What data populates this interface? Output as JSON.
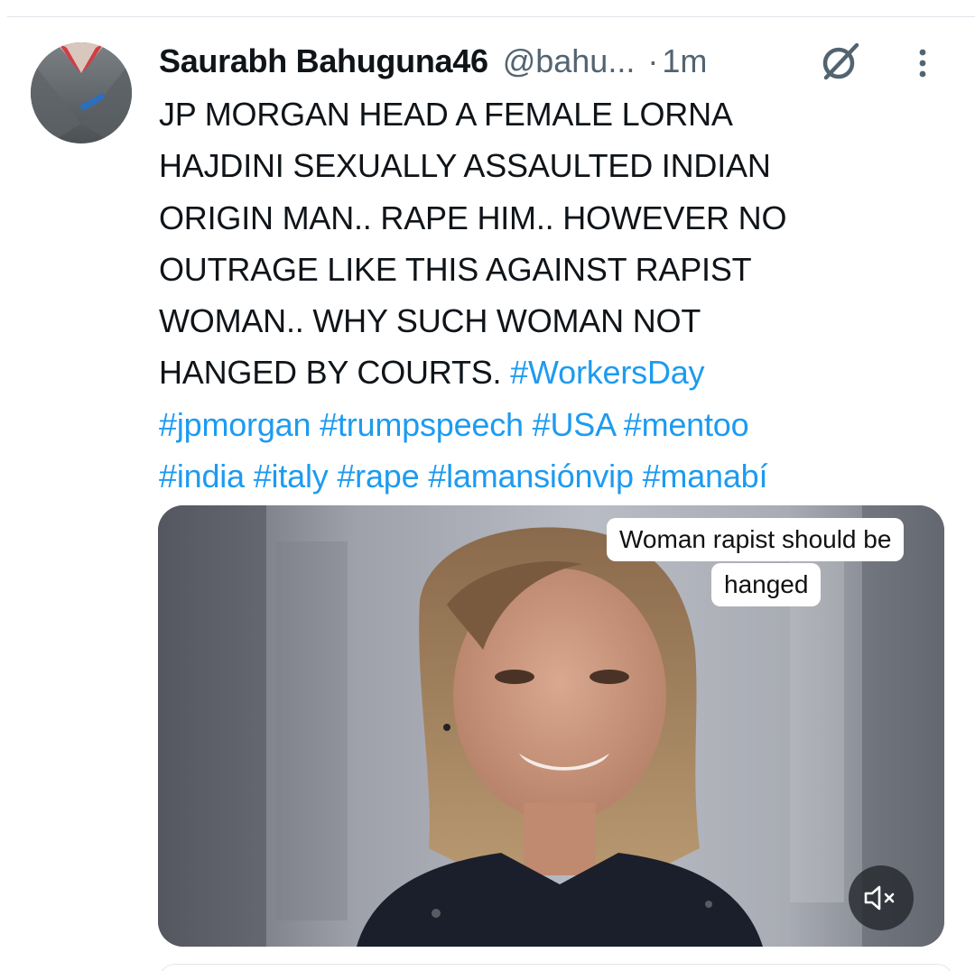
{
  "tweet": {
    "display_name": "Saurabh Bahuguna46",
    "handle": "@bahu...",
    "separator": "·",
    "time": "1m",
    "text_lines": [
      "JP MORGAN HEAD A FEMALE LORNA",
      "HAJDINI SEXUALLY ASSAULTED INDIAN",
      "ORIGIN MAN..  RAPE HIM.. HOWEVER NO",
      "OUTRAGE LIKE THIS AGAINST RAPIST",
      "WOMAN.. WHY SUCH WOMAN NOT",
      "HANGED BY COURTS."
    ],
    "hashtags": {
      "line6": [
        "#WorkersDay"
      ],
      "line7": [
        "#jpmorgan",
        "#trumpspeech",
        "#USA",
        "#mentoo"
      ],
      "line8": [
        "#india",
        "#italy",
        "#rape",
        "#lamansiónvip",
        "#manabí"
      ]
    }
  },
  "media": {
    "caption_line1": "Woman rapist should be",
    "caption_line2": "hanged",
    "mute_icon": "volume-muted-icon"
  },
  "icons": {
    "grok": "grok-icon",
    "more": "more-vertical-icon"
  },
  "colors": {
    "hashtag": "#1d9bf0",
    "secondary_text": "#536471",
    "primary_text": "#0f1419"
  }
}
